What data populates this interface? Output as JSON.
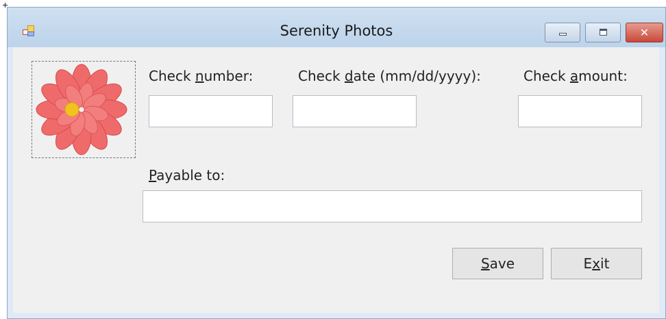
{
  "window": {
    "title": "Serenity Photos"
  },
  "form": {
    "check_number": {
      "label_pre": "Check ",
      "label_key": "n",
      "label_post": "umber:",
      "value": ""
    },
    "check_date": {
      "label_pre": "Check ",
      "label_key": "d",
      "label_post": "ate (mm/dd/yyyy):",
      "value": ""
    },
    "check_amount": {
      "label_pre": "Check ",
      "label_key": "a",
      "label_post": "mount:",
      "value": ""
    },
    "payable_to": {
      "label_pre": "",
      "label_key": "P",
      "label_post": "ayable to:",
      "value": ""
    }
  },
  "buttons": {
    "save": {
      "key": "S",
      "rest": "ave"
    },
    "exit": {
      "pre": "E",
      "key": "x",
      "rest": "it"
    }
  },
  "icons": {
    "app": "app-forms-icon",
    "picture": "flower-photo",
    "minimize": "minimize-icon",
    "maximize": "maximize-icon",
    "close": "close-icon"
  },
  "colors": {
    "titlebar": "#c7dbef",
    "client_background": "#f0f0f0",
    "close_button": "#c9483a",
    "flower_petal": "#ee5a5a",
    "flower_center": "#f2c21d"
  }
}
